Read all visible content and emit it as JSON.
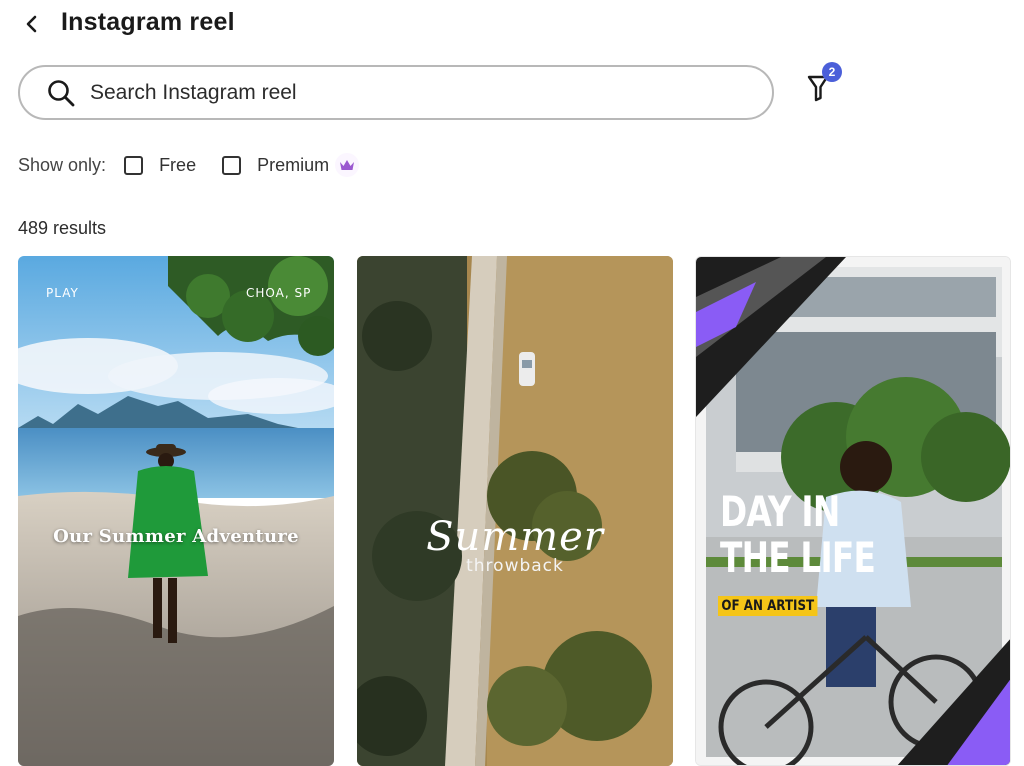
{
  "header": {
    "back_icon": "chevron-left-icon",
    "title": "Instagram reel"
  },
  "search": {
    "icon": "search-icon",
    "placeholder": "Search Instagram reel",
    "value": ""
  },
  "filter": {
    "icon": "filter-icon",
    "badge_count": "2",
    "badge_color": "#4b5fd9"
  },
  "show_only": {
    "label": "Show only:",
    "options": [
      {
        "label": "Free",
        "checked": false
      },
      {
        "label": "Premium",
        "checked": false,
        "icon": "crown-icon"
      }
    ],
    "premium_color": "#9b59d0"
  },
  "results": {
    "count_text": "489 results"
  },
  "templates": [
    {
      "title": "Our Summer Adventure",
      "tag_left": "PLAY",
      "tag_right": "CHOA, SP"
    },
    {
      "script_title": "Summer",
      "subtitle": "throwback"
    },
    {
      "headline_line1": "DAY IN",
      "headline_line2": "THE LIFE",
      "tag": "OF AN ARTIST",
      "accent": "#8a5cf5"
    }
  ]
}
